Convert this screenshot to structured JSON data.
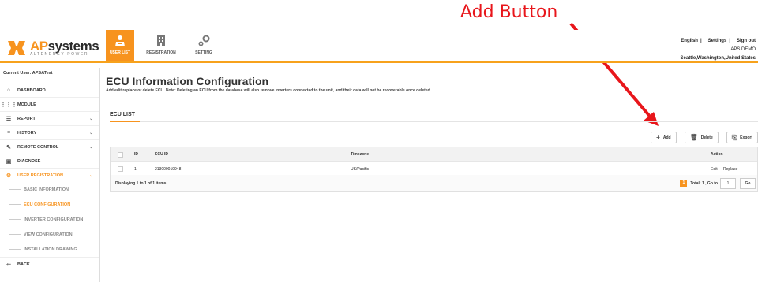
{
  "annotation": {
    "text": "Add Button",
    "color": "#e8161b"
  },
  "brand": {
    "name_part1": "AP",
    "name_part2": "systems",
    "tagline": "ALTENERGY POWER",
    "accent": "#f7931e"
  },
  "topnav": [
    {
      "label": "USER LIST",
      "icon": "users-icon",
      "active": true
    },
    {
      "label": "REGISTRATION",
      "icon": "building-icon",
      "active": false
    },
    {
      "label": "SETTING",
      "icon": "gears-icon",
      "active": false
    }
  ],
  "header_right": {
    "links": [
      "English",
      "Settings",
      "Sign out"
    ],
    "account": "APS DEMO",
    "location": "Seattle,Washington,United States"
  },
  "sidebar": {
    "current_user": "Current User: APSATest",
    "items": [
      {
        "label": "DASHBOARD",
        "icon": "home-icon"
      },
      {
        "label": "MODULE",
        "icon": "grid-icon"
      },
      {
        "label": "REPORT",
        "icon": "list-icon",
        "chevron": "⌄"
      },
      {
        "label": "HISTORY",
        "icon": "database-icon",
        "chevron": "⌄"
      },
      {
        "label": "REMOTE CONTROL",
        "icon": "wrench-icon",
        "chevron": "⌄"
      },
      {
        "label": "DIAGNOSE",
        "icon": "diagnose-icon"
      },
      {
        "label": "USER REGISTRATION",
        "icon": "cogs-icon",
        "chevron": "⌄"
      }
    ],
    "subitems": [
      {
        "label": "BASIC INFORMATION"
      },
      {
        "label": "ECU CONFIGURATION"
      },
      {
        "label": "INVERTER CONFIGURATION"
      },
      {
        "label": "VIEW CONFIGURATION"
      },
      {
        "label": "INSTALLATION DRAWING"
      }
    ],
    "back": {
      "label": "BACK",
      "icon": "back-icon"
    }
  },
  "main": {
    "title": "ECU Information Configuration",
    "description": "Add,edit,replace or delete ECU. Note: Deleting an ECU from the database will also remove Inverters connected to the unit, and their data will not be recoverable once deleted.",
    "section_title": "ECU LIST",
    "toolbar": {
      "add": "Add",
      "delete": "Delete",
      "export": "Export",
      "add_icon": "plus-icon",
      "delete_icon": "trash-icon",
      "export_icon": "export-icon"
    },
    "table": {
      "columns": [
        "ID",
        "ECU ID",
        "Timezone",
        "Action"
      ],
      "rows": [
        {
          "id": "1",
          "ecu_id": "213000019948",
          "timezone": "US/Pacific",
          "edit": "Edit",
          "replace": "Replace"
        }
      ]
    },
    "pager": {
      "summary": "Displaying 1 to 1 of 1 items.",
      "current_page": "1",
      "total_text": "Total: 1 , Go to",
      "goto_value": "1",
      "go": "Go"
    }
  }
}
